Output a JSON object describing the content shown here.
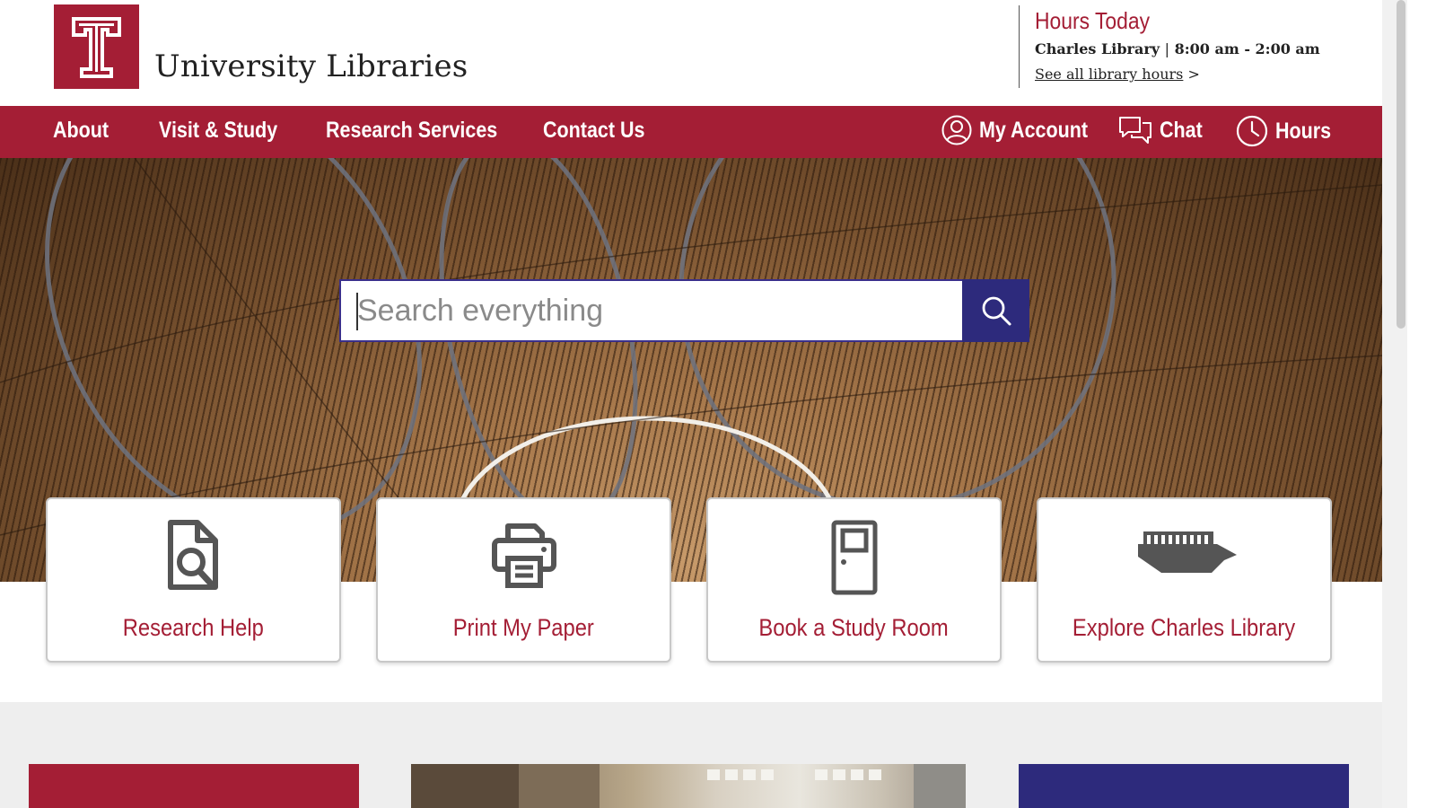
{
  "header": {
    "logo_alt": "T",
    "site_title": "University Libraries",
    "hours": {
      "title": "Hours Today",
      "location": "Charles Library",
      "separator": "|",
      "time": "8:00 am - 2:00 am",
      "link_text": "See all library hours",
      "link_arrow": ">"
    }
  },
  "nav": {
    "items": [
      {
        "label": "About"
      },
      {
        "label": "Visit & Study"
      },
      {
        "label": "Research Services"
      },
      {
        "label": "Contact Us"
      }
    ],
    "utility": {
      "account": "My Account",
      "chat": "Chat",
      "hours": "Hours"
    }
  },
  "search": {
    "placeholder": "Search everything",
    "value": ""
  },
  "quick_links": [
    {
      "label": "Research Help",
      "icon": "document-search-icon"
    },
    {
      "label": "Print My Paper",
      "icon": "printer-icon"
    },
    {
      "label": "Book a Study Room",
      "icon": "door-icon"
    },
    {
      "label": "Explore Charles Library",
      "icon": "library-building-icon"
    }
  ],
  "colors": {
    "brand_red": "#a41e35",
    "brand_purple": "#2d2a7c"
  }
}
